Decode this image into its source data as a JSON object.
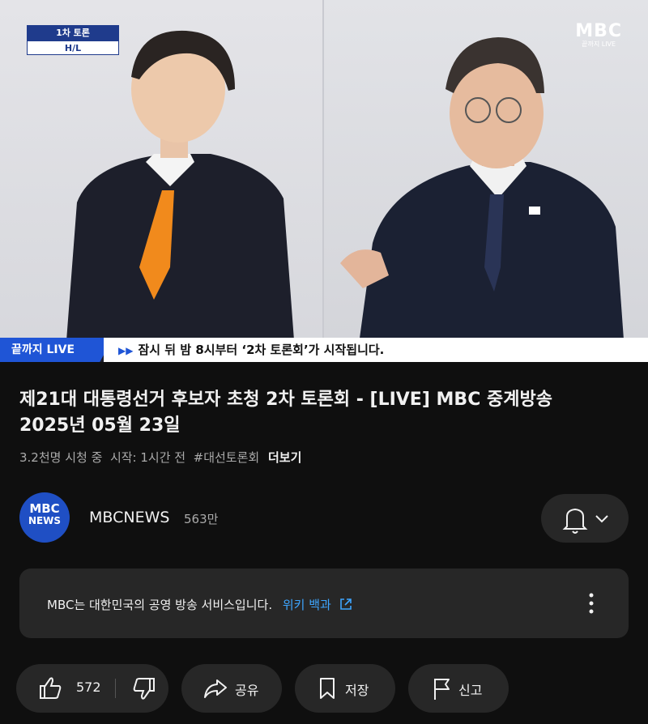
{
  "video": {
    "badge_top": "1차 토론",
    "badge_bottom": "H/L",
    "logo_main": "MBC",
    "logo_sub": "끝까지 LIVE",
    "ticker_label": "끝까지 LIVE",
    "ticker_arrows": "▶▶",
    "ticker_text": "잠시 뒤 밤 8시부터 ‘2차 토론회’가 시작됩니다."
  },
  "title_line1": "제21대 대통령선거 후보자 초청 2차 토론회 - [LIVE] MBC 중계방송",
  "title_line2": "2025년 05월 23일",
  "meta": {
    "views": "3.2천명 시청 중",
    "started": "시작: 1시간 전",
    "hashtag": "#대선토론회",
    "more": "더보기"
  },
  "channel": {
    "avatar_line1": "MBC",
    "avatar_line2": "NEWS",
    "name": "MBCNEWS",
    "subscribers": "563만"
  },
  "info": {
    "text": "MBC는 대한민국의 공영 방송 서비스입니다.",
    "link": "위키 백과"
  },
  "actions": {
    "likes": "572",
    "share": "공유",
    "save": "저장",
    "report": "신고"
  },
  "colors": {
    "background": "#0f0f0f",
    "surface": "#272727",
    "link": "#3ea6ff",
    "broadcast_blue": "#1f55d6"
  }
}
